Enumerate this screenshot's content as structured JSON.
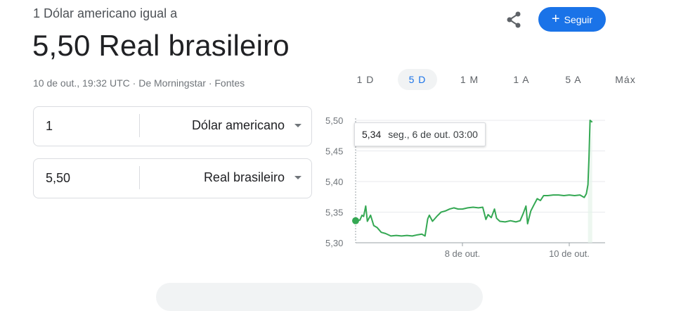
{
  "header": {
    "subtitle": "1 Dólar americano igual a",
    "rate_text": "5,50 Real brasileiro",
    "timestamp": "10 de out., 19:32 UTC",
    "source": "De Morningstar",
    "sources_link": "Fontes",
    "separator": "·"
  },
  "actions": {
    "share_icon": "share-icon",
    "follow_label": "Seguir",
    "follow_icon": "plus-icon"
  },
  "converter": {
    "from": {
      "amount": "1",
      "currency": "Dólar americano"
    },
    "to": {
      "amount": "5,50",
      "currency": "Real brasileiro"
    }
  },
  "ranges": {
    "tabs": [
      "1 D",
      "5 D",
      "1 M",
      "1 A",
      "5 A",
      "Máx"
    ],
    "active": "5 D"
  },
  "tooltip": {
    "value": "5,34",
    "date": "seg., 6 de out. 03:00"
  },
  "colors": {
    "line": "#34a853",
    "accent": "#1a73e8",
    "grid": "#e8eaed"
  },
  "chart_data": {
    "type": "line",
    "title": "",
    "xlabel": "",
    "ylabel": "",
    "ylim": [
      5.3,
      5.5
    ],
    "y_ticks": [
      "5,50",
      "5,45",
      "5,40",
      "5,35",
      "5,30"
    ],
    "y_tick_values": [
      5.5,
      5.45,
      5.4,
      5.35,
      5.3
    ],
    "x_ticks": [
      {
        "label": "8 de out.",
        "t": 2.0
      },
      {
        "label": "10 de out.",
        "t": 4.0
      }
    ],
    "x_range": [
      0,
      4.6
    ],
    "series": [
      {
        "values": [
          [
            0.0,
            5.336
          ],
          [
            0.08,
            5.337
          ],
          [
            0.12,
            5.345
          ],
          [
            0.15,
            5.343
          ],
          [
            0.19,
            5.36
          ],
          [
            0.22,
            5.335
          ],
          [
            0.28,
            5.345
          ],
          [
            0.34,
            5.328
          ],
          [
            0.4,
            5.325
          ],
          [
            0.48,
            5.317
          ],
          [
            0.56,
            5.315
          ],
          [
            0.66,
            5.311
          ],
          [
            0.76,
            5.312
          ],
          [
            0.86,
            5.311
          ],
          [
            0.96,
            5.312
          ],
          [
            1.06,
            5.311
          ],
          [
            1.16,
            5.313
          ],
          [
            1.24,
            5.314
          ],
          [
            1.3,
            5.311
          ],
          [
            1.33,
            5.328
          ],
          [
            1.35,
            5.339
          ],
          [
            1.38,
            5.345
          ],
          [
            1.44,
            5.335
          ],
          [
            1.52,
            5.343
          ],
          [
            1.6,
            5.35
          ],
          [
            1.68,
            5.352
          ],
          [
            1.76,
            5.355
          ],
          [
            1.84,
            5.357
          ],
          [
            1.92,
            5.355
          ],
          [
            2.0,
            5.355
          ],
          [
            2.1,
            5.357
          ],
          [
            2.2,
            5.358
          ],
          [
            2.3,
            5.357
          ],
          [
            2.38,
            5.358
          ],
          [
            2.44,
            5.338
          ],
          [
            2.48,
            5.346
          ],
          [
            2.54,
            5.341
          ],
          [
            2.6,
            5.355
          ],
          [
            2.64,
            5.34
          ],
          [
            2.7,
            5.335
          ],
          [
            2.8,
            5.334
          ],
          [
            2.9,
            5.336
          ],
          [
            3.0,
            5.334
          ],
          [
            3.08,
            5.336
          ],
          [
            3.14,
            5.348
          ],
          [
            3.19,
            5.36
          ],
          [
            3.22,
            5.331
          ],
          [
            3.28,
            5.352
          ],
          [
            3.34,
            5.362
          ],
          [
            3.4,
            5.372
          ],
          [
            3.46,
            5.369
          ],
          [
            3.52,
            5.377
          ],
          [
            3.6,
            5.377
          ],
          [
            3.7,
            5.378
          ],
          [
            3.8,
            5.378
          ],
          [
            3.9,
            5.377
          ],
          [
            4.0,
            5.378
          ],
          [
            4.1,
            5.377
          ],
          [
            4.2,
            5.378
          ],
          [
            4.28,
            5.374
          ],
          [
            4.32,
            5.38
          ],
          [
            4.35,
            5.395
          ],
          [
            4.37,
            5.44
          ],
          [
            4.39,
            5.5
          ],
          [
            4.43,
            5.497
          ]
        ]
      }
    ],
    "marker": {
      "t": 0.0,
      "value": 5.336
    },
    "grid": true
  },
  "bottom": {
    "pill": ""
  }
}
